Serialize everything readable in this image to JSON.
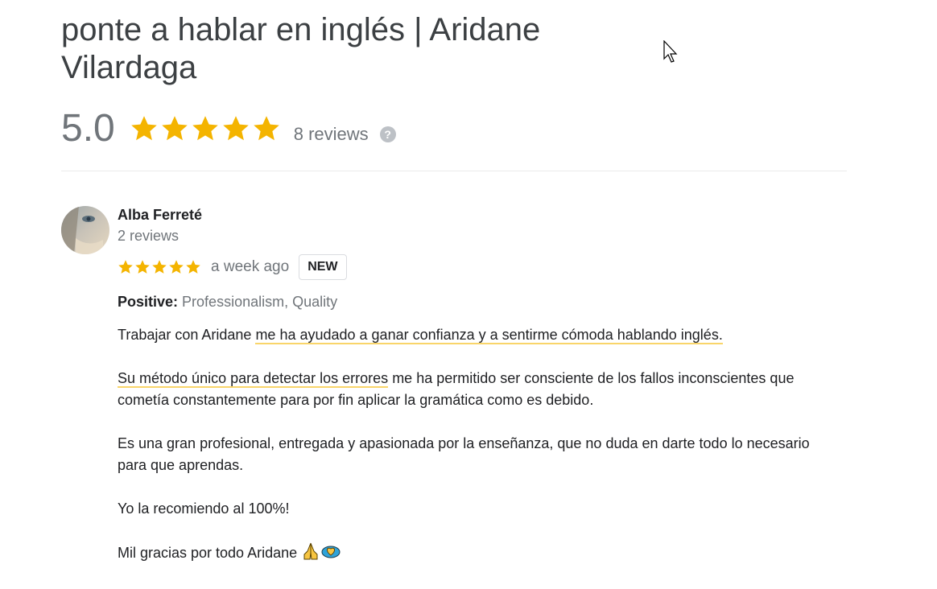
{
  "place": {
    "title": "ponte a hablar en inglés | Aridane Vilardaga",
    "rating": "5.0",
    "stars": 5,
    "review_count_label": "8 reviews",
    "help_symbol": "?"
  },
  "review": {
    "author": "Alba Ferreté",
    "author_reviews": "2 reviews",
    "stars": 5,
    "time": "a week ago",
    "badge": "NEW",
    "positive_label": "Positive:",
    "positive_values": "Professionalism, Quality",
    "p1_plain": "Trabajar con Aridane ",
    "p1_highlight": "me ha ayudado a ganar confianza y a sentirme cómoda hablando inglés.",
    "p2_highlight": "Su método único para detectar los errores",
    "p2_plain": " me ha permitido ser consciente de los fallos inconscientes que cometía constantemente para por fin aplicar la gramática como es debido.",
    "p3": "Es una gran profesional, entregada y apasionada por la enseñanza, que no duda en darte todo lo necesario para que aprendas.",
    "p4": "Yo la recomiendo al 100%!",
    "p5": "Mil gracias por todo Aridane "
  },
  "icons": {
    "star_color": "#f4b400",
    "help_icon": "question-circle-icon",
    "emojis": [
      "folded-hands-icon",
      "heart-sparkle-icon"
    ]
  }
}
